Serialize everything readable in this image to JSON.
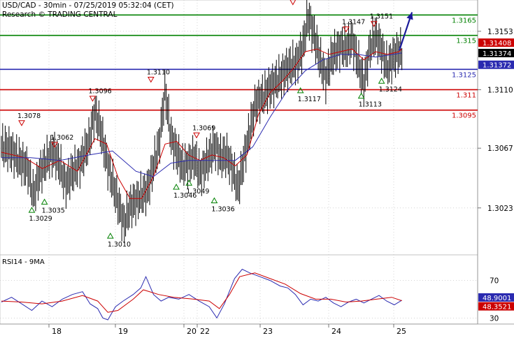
{
  "header": {
    "title": "USD/CAD - 30min - 07/25/2019 05:32:04 (CET)",
    "source": "Research © TRADING CENTRAL"
  },
  "colors": {
    "price": "#000000",
    "ma_fast": "#cc0000",
    "ma_slow": "#2a2ab0",
    "resistance": "#cc0000",
    "support": "#2a2ab0",
    "target": "#008000",
    "pivot": "#2a2ab0",
    "arrow": "#1a1a99",
    "grid": "#bbbbbb",
    "rsi": "#2a2ab0",
    "rsi_ma": "#cc0000",
    "marker_high": "#cc0000",
    "marker_low": "#008000"
  },
  "chart_data": [
    {
      "type": "line",
      "title": "USD/CAD - 30min - 07/25/2019 05:32:04 (CET)",
      "x_ticks": [
        "18",
        "19",
        "20",
        "22",
        "23",
        "24",
        "25"
      ],
      "y_ticks": [
        1.3023,
        1.3067,
        1.311,
        1.3153
      ],
      "ylim": [
        1.299,
        1.3175
      ],
      "grid": true,
      "price_path": [
        [
          0,
          1.3068
        ],
        [
          3,
          1.3066
        ],
        [
          6,
          1.3058
        ],
        [
          9,
          1.3052
        ],
        [
          11,
          1.3032
        ],
        [
          13,
          1.3048
        ],
        [
          16,
          1.306
        ],
        [
          18,
          1.3064
        ],
        [
          20,
          1.3054
        ],
        [
          22,
          1.304
        ],
        [
          24,
          1.3048
        ],
        [
          27,
          1.3056
        ],
        [
          30,
          1.3072
        ],
        [
          32,
          1.3094
        ],
        [
          34,
          1.308
        ],
        [
          36,
          1.3058
        ],
        [
          38,
          1.3042
        ],
        [
          40,
          1.3026
        ],
        [
          42,
          1.3011
        ],
        [
          44,
          1.3024
        ],
        [
          47,
          1.303
        ],
        [
          50,
          1.3036
        ],
        [
          52,
          1.3054
        ],
        [
          54,
          1.307
        ],
        [
          56,
          1.311
        ],
        [
          58,
          1.3075
        ],
        [
          60,
          1.3064
        ],
        [
          62,
          1.3053
        ],
        [
          64,
          1.3056
        ],
        [
          66,
          1.306
        ],
        [
          68,
          1.3048
        ],
        [
          71,
          1.306
        ],
        [
          73,
          1.3069
        ],
        [
          75,
          1.306
        ],
        [
          77,
          1.3062
        ],
        [
          79,
          1.3052
        ],
        [
          81,
          1.3037
        ],
        [
          83,
          1.306
        ],
        [
          85,
          1.308
        ],
        [
          87,
          1.31
        ],
        [
          90,
          1.3106
        ],
        [
          92,
          1.3112
        ],
        [
          95,
          1.3118
        ],
        [
          98,
          1.3126
        ],
        [
          101,
          1.313
        ],
        [
          103,
          1.314
        ],
        [
          105,
          1.3164
        ],
        [
          107,
          1.315
        ],
        [
          109,
          1.3132
        ],
        [
          111,
          1.3118
        ],
        [
          113,
          1.3134
        ],
        [
          116,
          1.3142
        ],
        [
          118,
          1.314
        ],
        [
          120,
          1.3147
        ],
        [
          122,
          1.313
        ],
        [
          124,
          1.3114
        ],
        [
          126,
          1.314
        ],
        [
          128,
          1.315
        ],
        [
          130,
          1.314
        ],
        [
          132,
          1.3126
        ],
        [
          134,
          1.3134
        ],
        [
          136,
          1.3138
        ],
        [
          137,
          1.3137
        ]
      ],
      "ma_fast_path": [
        [
          0,
          1.3064
        ],
        [
          8,
          1.306
        ],
        [
          14,
          1.3052
        ],
        [
          20,
          1.3058
        ],
        [
          26,
          1.305
        ],
        [
          32,
          1.3074
        ],
        [
          36,
          1.307
        ],
        [
          40,
          1.3045
        ],
        [
          44,
          1.303
        ],
        [
          48,
          1.303
        ],
        [
          52,
          1.3046
        ],
        [
          56,
          1.307
        ],
        [
          60,
          1.3072
        ],
        [
          64,
          1.3062
        ],
        [
          68,
          1.3058
        ],
        [
          72,
          1.3062
        ],
        [
          76,
          1.306
        ],
        [
          80,
          1.3054
        ],
        [
          84,
          1.3062
        ],
        [
          88,
          1.3092
        ],
        [
          92,
          1.3108
        ],
        [
          96,
          1.3116
        ],
        [
          100,
          1.3126
        ],
        [
          104,
          1.3138
        ],
        [
          108,
          1.314
        ],
        [
          112,
          1.3136
        ],
        [
          116,
          1.3138
        ],
        [
          120,
          1.314
        ],
        [
          124,
          1.3132
        ],
        [
          128,
          1.3138
        ],
        [
          132,
          1.3136
        ],
        [
          136,
          1.3138
        ],
        [
          137,
          1.314
        ]
      ],
      "ma_slow_path": [
        [
          0,
          1.306
        ],
        [
          10,
          1.306
        ],
        [
          20,
          1.3058
        ],
        [
          30,
          1.3062
        ],
        [
          38,
          1.3065
        ],
        [
          46,
          1.305
        ],
        [
          52,
          1.3046
        ],
        [
          58,
          1.3056
        ],
        [
          64,
          1.3058
        ],
        [
          72,
          1.3058
        ],
        [
          80,
          1.3058
        ],
        [
          86,
          1.3068
        ],
        [
          92,
          1.309
        ],
        [
          98,
          1.311
        ],
        [
          104,
          1.3124
        ],
        [
          110,
          1.3132
        ],
        [
          116,
          1.3136
        ],
        [
          122,
          1.3136
        ],
        [
          128,
          1.3134
        ],
        [
          134,
          1.3136
        ],
        [
          137,
          1.3137
        ]
      ],
      "levels": [
        {
          "value": 1.3165,
          "label": "1.3165",
          "kind": "target"
        },
        {
          "value": 1.315,
          "label": "1.315",
          "kind": "target"
        },
        {
          "value": 1.3125,
          "label": "1.3125",
          "kind": "pivot"
        },
        {
          "value": 1.311,
          "label": "1.311",
          "kind": "resistance"
        },
        {
          "value": 1.3095,
          "label": "1.3095",
          "kind": "resistance"
        }
      ],
      "price_tags": [
        {
          "value": 1.314,
          "label": "1.31408",
          "kind": "ma_fast"
        },
        {
          "value": 1.3137,
          "label": "1.31374",
          "kind": "price"
        },
        {
          "value": 1.3133,
          "label": "1.31372",
          "kind": "ma_slow"
        }
      ],
      "annotations": [
        {
          "x": 12,
          "value": 1.3029,
          "label": "1.3029",
          "kind": "low"
        },
        {
          "x": 17,
          "value": 1.3035,
          "label": "1.3035",
          "kind": "low"
        },
        {
          "x": 43,
          "value": 1.301,
          "label": "1.3010",
          "kind": "low"
        },
        {
          "x": 69,
          "value": 1.3046,
          "label": "1.3046",
          "kind": "low"
        },
        {
          "x": 74,
          "value": 1.3049,
          "label": "1.3049",
          "kind": "low"
        },
        {
          "x": 84,
          "value": 1.3036,
          "label": "1.3036",
          "kind": "low"
        },
        {
          "x": 118,
          "value": 1.3117,
          "label": "1.3117",
          "kind": "low"
        },
        {
          "x": 142,
          "value": 1.3113,
          "label": "1.3113",
          "kind": "low"
        },
        {
          "x": 150,
          "value": 1.3124,
          "label": "1.3124",
          "kind": "low"
        },
        {
          "x": 8,
          "value": 1.3078,
          "label": "1.3078",
          "kind": "high"
        },
        {
          "x": 21,
          "value": 1.3062,
          "label": "1.3062",
          "kind": "high"
        },
        {
          "x": 36,
          "value": 1.3096,
          "label": "1.3096",
          "kind": "high"
        },
        {
          "x": 59,
          "value": 1.311,
          "label": "1.3110",
          "kind": "high"
        },
        {
          "x": 77,
          "value": 1.3069,
          "label": "1.3069",
          "kind": "high"
        },
        {
          "x": 115,
          "value": 1.3167,
          "label": "",
          "kind": "high"
        },
        {
          "x": 136,
          "value": 1.3147,
          "label": "1.3147",
          "kind": "high"
        },
        {
          "x": 147,
          "value": 1.3151,
          "label": "1.3151",
          "kind": "high"
        }
      ],
      "forecast_arrow": {
        "from": [
          157,
          1.3139
        ],
        "to": [
          162,
          1.3167
        ]
      }
    },
    {
      "type": "line",
      "title": "RSI14 - 9MA",
      "ylim": [
        25,
        95
      ],
      "y_ticks": [
        30,
        70
      ],
      "rsi_path": [
        [
          0,
          47
        ],
        [
          4,
          52
        ],
        [
          8,
          45
        ],
        [
          12,
          38
        ],
        [
          16,
          48
        ],
        [
          20,
          42
        ],
        [
          24,
          50
        ],
        [
          28,
          55
        ],
        [
          32,
          58
        ],
        [
          35,
          45
        ],
        [
          38,
          40
        ],
        [
          40,
          30
        ],
        [
          42,
          28
        ],
        [
          45,
          42
        ],
        [
          48,
          48
        ],
        [
          52,
          55
        ],
        [
          55,
          62
        ],
        [
          57,
          74
        ],
        [
          60,
          55
        ],
        [
          63,
          48
        ],
        [
          66,
          52
        ],
        [
          70,
          50
        ],
        [
          74,
          55
        ],
        [
          78,
          48
        ],
        [
          82,
          42
        ],
        [
          85,
          30
        ],
        [
          88,
          45
        ],
        [
          92,
          72
        ],
        [
          95,
          82
        ],
        [
          98,
          78
        ],
        [
          102,
          74
        ],
        [
          106,
          70
        ],
        [
          110,
          64
        ],
        [
          113,
          62
        ],
        [
          116,
          55
        ],
        [
          119,
          44
        ],
        [
          122,
          50
        ],
        [
          125,
          48
        ],
        [
          128,
          52
        ],
        [
          131,
          46
        ],
        [
          134,
          42
        ],
        [
          137,
          47
        ],
        [
          140,
          50
        ],
        [
          143,
          46
        ],
        [
          146,
          50
        ],
        [
          149,
          54
        ],
        [
          152,
          48
        ],
        [
          155,
          44
        ],
        [
          158,
          48.9
        ]
      ],
      "rsi_ma_path": [
        [
          0,
          48
        ],
        [
          8,
          47
        ],
        [
          16,
          45
        ],
        [
          24,
          48
        ],
        [
          32,
          54
        ],
        [
          38,
          48
        ],
        [
          42,
          36
        ],
        [
          46,
          38
        ],
        [
          52,
          50
        ],
        [
          56,
          60
        ],
        [
          62,
          55
        ],
        [
          68,
          52
        ],
        [
          76,
          50
        ],
        [
          82,
          48
        ],
        [
          86,
          40
        ],
        [
          90,
          55
        ],
        [
          94,
          74
        ],
        [
          100,
          78
        ],
        [
          106,
          72
        ],
        [
          112,
          66
        ],
        [
          118,
          56
        ],
        [
          124,
          50
        ],
        [
          130,
          50
        ],
        [
          136,
          47
        ],
        [
          142,
          48
        ],
        [
          148,
          50
        ],
        [
          154,
          52
        ],
        [
          158,
          48.35
        ]
      ],
      "tags": [
        {
          "value": 48.9001,
          "label": "48.9001",
          "kind": "rsi"
        },
        {
          "value": 48.3521,
          "label": "48.3521",
          "kind": "rsi_ma"
        }
      ]
    }
  ]
}
